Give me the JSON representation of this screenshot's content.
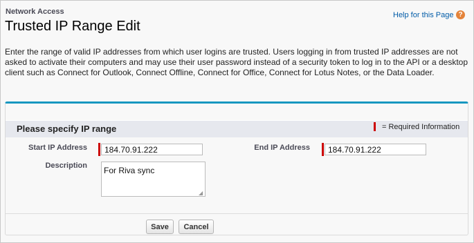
{
  "header": {
    "section_label": "Network Access",
    "page_title": "Trusted IP Range Edit",
    "help_link": "Help for this Page",
    "help_icon": "?"
  },
  "intro_text": "Enter the range of valid IP addresses from which user logins are trusted. Users logging in from trusted IP addresses are not asked to activate their computers and may use their user password instead of a security token to log in to the API or a desktop client such as Connect for Outlook, Connect Offline, Connect for Office, Connect for Lotus Notes, or the Data Loader.",
  "panel": {
    "title": "Please specify IP range",
    "required_info": "= Required Information"
  },
  "form": {
    "start_ip_label": "Start IP Address",
    "start_ip_value": "184.70.91.222",
    "end_ip_label": "End IP Address",
    "end_ip_value": "184.70.91.222",
    "description_label": "Description",
    "description_value": "For Riva sync"
  },
  "buttons": {
    "save": "Save",
    "cancel": "Cancel"
  },
  "colors": {
    "accent_border": "#1797c0",
    "required_red": "#cc0000",
    "link_blue": "#015ba7",
    "help_icon_orange": "#e4833a"
  }
}
